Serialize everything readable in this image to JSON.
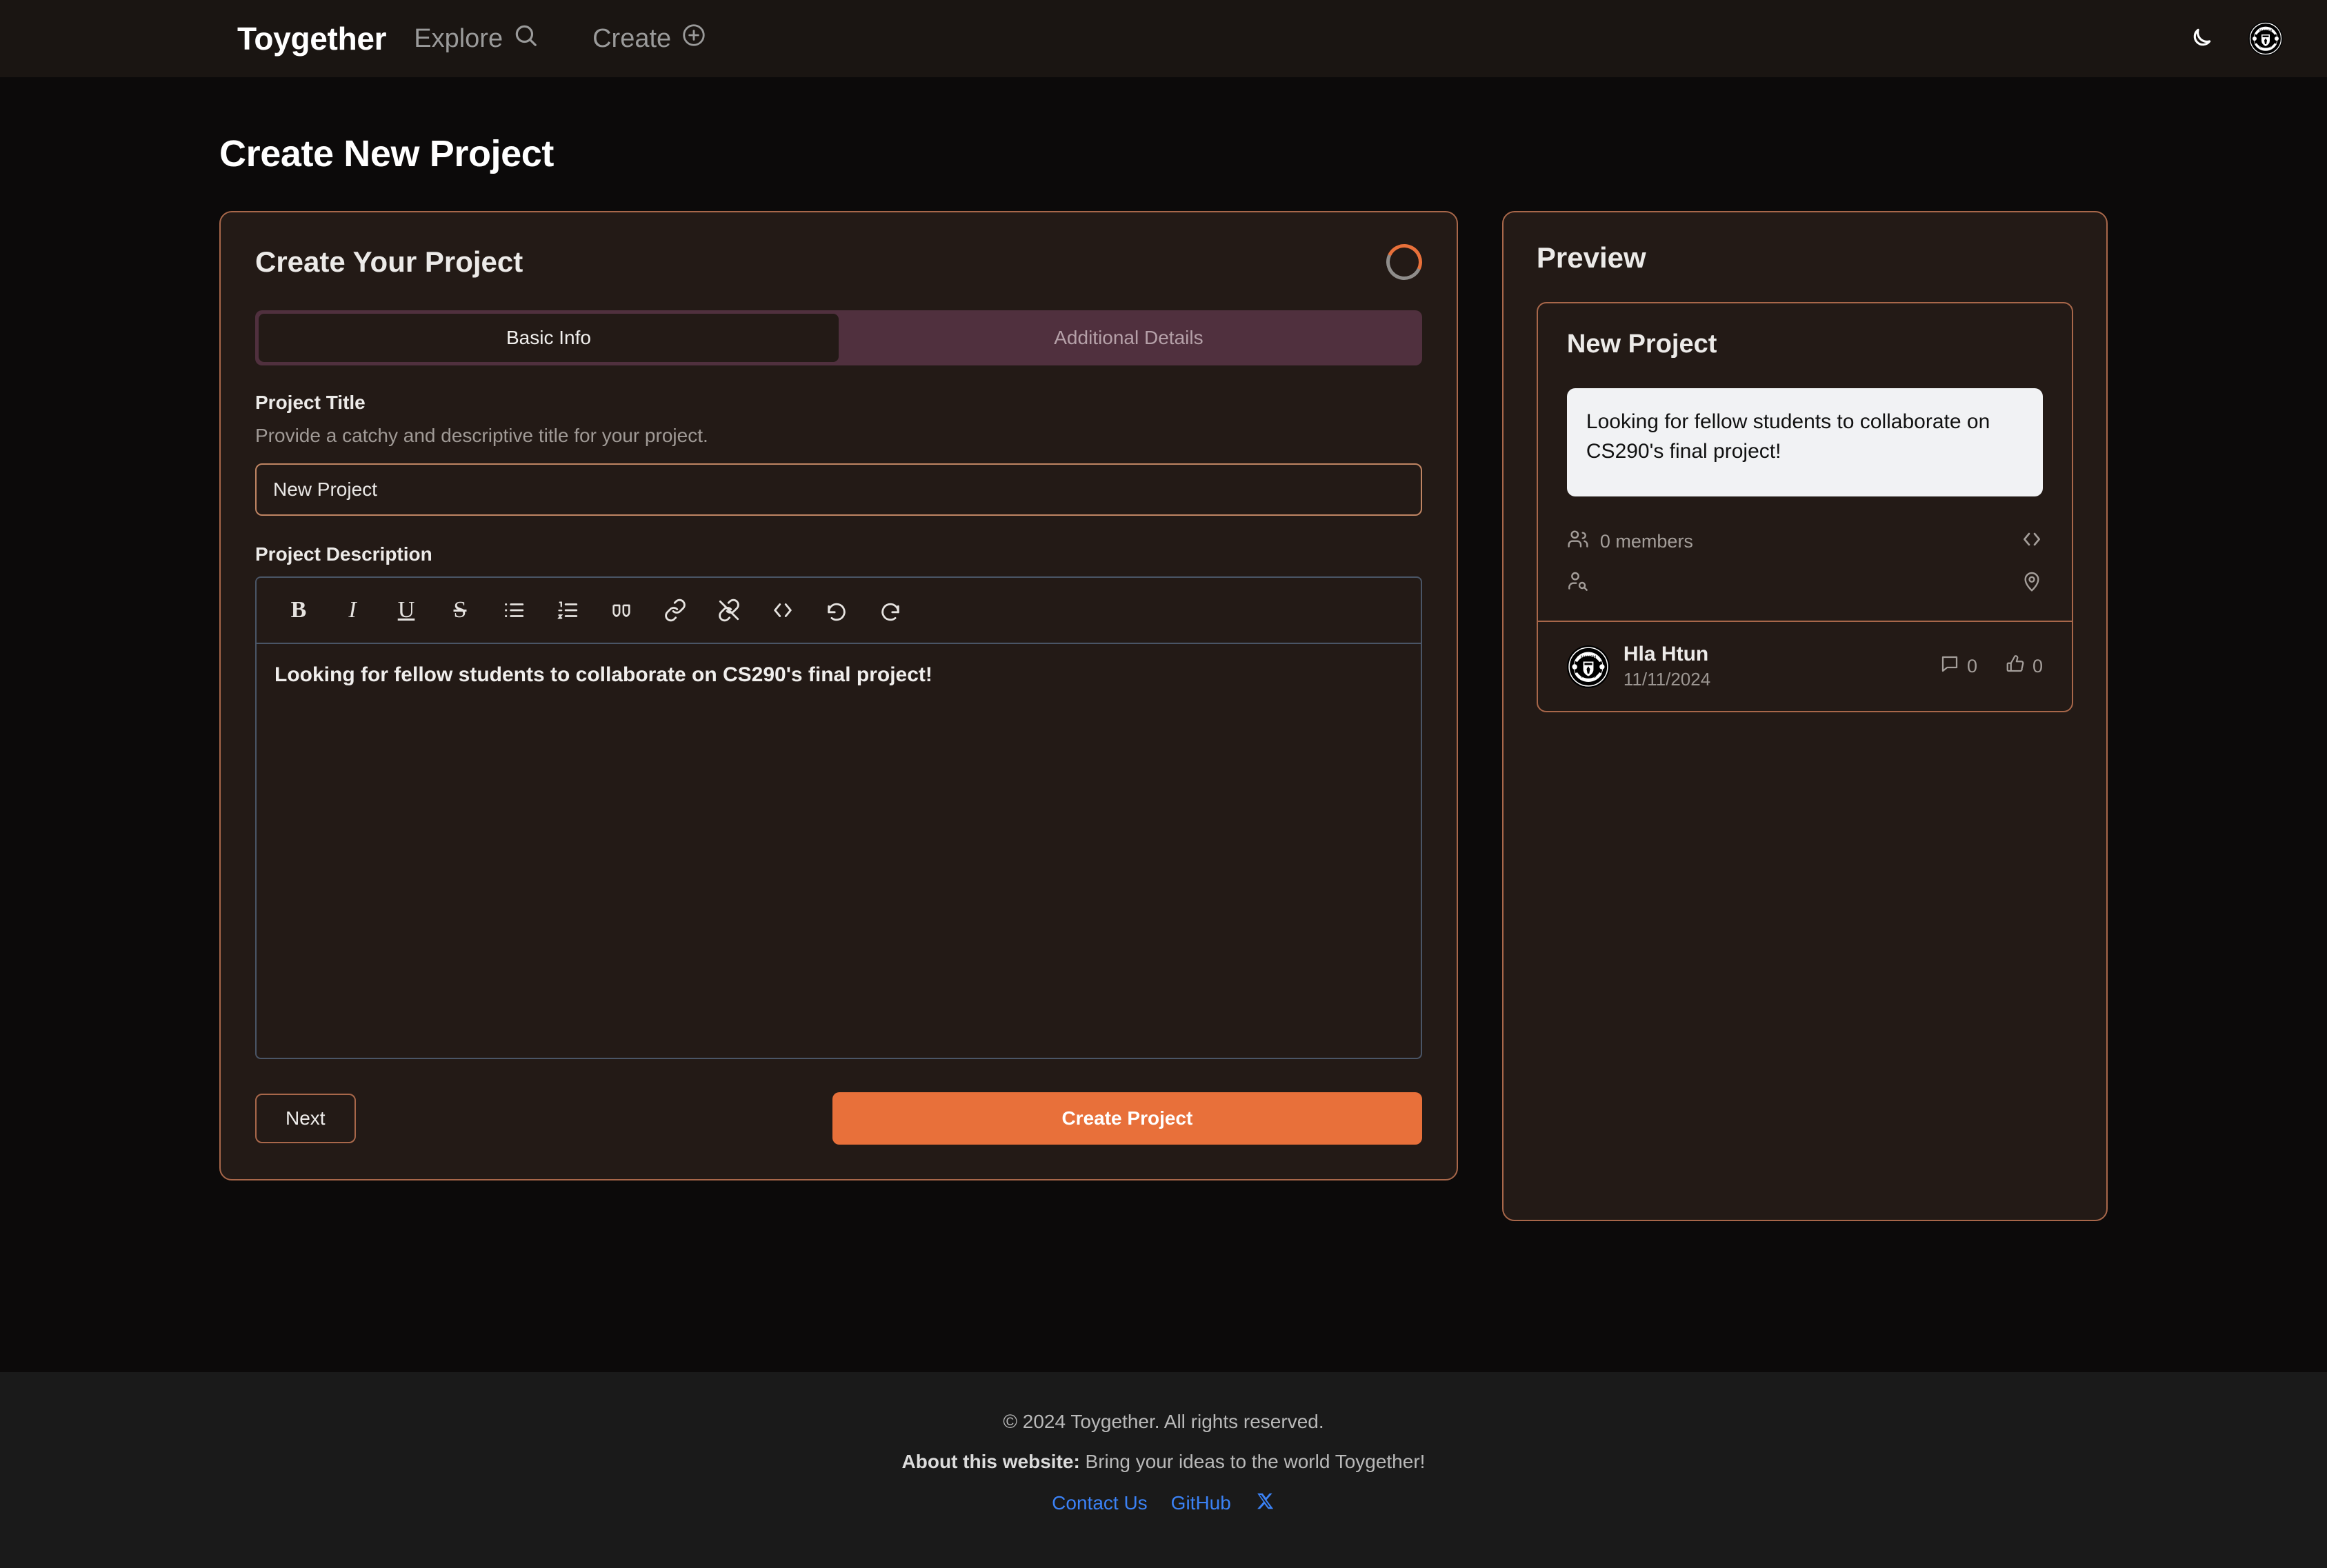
{
  "navbar": {
    "brand": "Toygether",
    "links": [
      {
        "label": "Explore",
        "icon": "search-icon"
      },
      {
        "label": "Create",
        "icon": "plus-circle-icon"
      }
    ],
    "theme_toggle_icon": "moon-icon",
    "avatar_icon": "manchester-united-crest"
  },
  "page": {
    "title": "Create New Project"
  },
  "form_card": {
    "title": "Create Your Project",
    "spinner_colors": {
      "track": "#8f8d8b",
      "accent": "#e8703a"
    },
    "tabs": [
      {
        "label": "Basic Info",
        "active": true
      },
      {
        "label": "Additional Details",
        "active": false
      }
    ],
    "project_title": {
      "label": "Project Title",
      "help": "Provide a catchy and descriptive title for your project.",
      "value": "New Project",
      "placeholder": "Project Title"
    },
    "project_description": {
      "label": "Project Description",
      "content": "Looking for fellow students to collaborate on CS290's final project!",
      "toolbar": [
        {
          "name": "bold-icon",
          "glyph": "B"
        },
        {
          "name": "italic-icon",
          "glyph": "I"
        },
        {
          "name": "underline-icon",
          "glyph": "U"
        },
        {
          "name": "strikethrough-icon",
          "glyph": "S"
        },
        {
          "name": "bullet-list-icon",
          "glyph": ""
        },
        {
          "name": "ordered-list-icon",
          "glyph": ""
        },
        {
          "name": "blockquote-icon",
          "glyph": ""
        },
        {
          "name": "link-icon",
          "glyph": ""
        },
        {
          "name": "unlink-icon",
          "glyph": ""
        },
        {
          "name": "code-icon",
          "glyph": ""
        },
        {
          "name": "undo-icon",
          "glyph": ""
        },
        {
          "name": "redo-icon",
          "glyph": ""
        }
      ]
    },
    "buttons": {
      "next": "Next",
      "create": "Create Project",
      "create_color": "#e8703a"
    }
  },
  "preview": {
    "title": "Preview",
    "project_title": "New Project",
    "description": "Looking for fellow students to collaborate on CS290's final project!",
    "members": "0 members",
    "meta_icons": [
      "users-icon",
      "code-icon",
      "user-search-icon",
      "location-pin-icon"
    ],
    "author": "Hla Htun",
    "date": "11/11/2024",
    "comments": "0",
    "likes": "0"
  },
  "footer": {
    "copyright": "© 2024 Toygether. All rights reserved.",
    "about_label": "About this website:",
    "about_text": " Bring your ideas to the world Toygether!",
    "links": [
      {
        "label": "Contact Us"
      },
      {
        "label": "GitHub"
      }
    ],
    "x_icon": "x-twitter-icon",
    "link_color": "#3b82f6"
  }
}
